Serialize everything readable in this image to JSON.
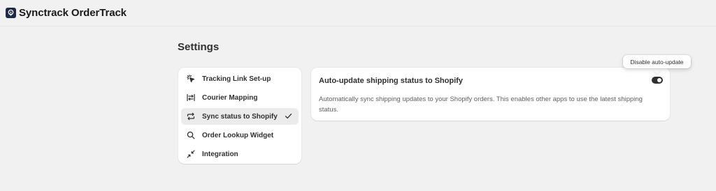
{
  "app": {
    "title": "Synctrack OrderTrack",
    "logo_icon": "location-pin-logo-icon",
    "logo_color": "#1e2a4a"
  },
  "page": {
    "title": "Settings"
  },
  "nav": {
    "items": [
      {
        "label": "Tracking Link Set-up",
        "icon": "cursor-click-icon",
        "active": false
      },
      {
        "label": "Courier Mapping",
        "icon": "mapping-arrows-icon",
        "active": false
      },
      {
        "label": "Sync status to Shopify",
        "icon": "sync-arrows-icon",
        "active": true
      },
      {
        "label": "Order Lookup Widget",
        "icon": "search-icon",
        "active": false
      },
      {
        "label": "Integration",
        "icon": "connect-arrows-icon",
        "active": false
      }
    ],
    "selected_indicator_icon": "checkmark-icon"
  },
  "setting": {
    "title": "Auto-update shipping status to Shopify",
    "description": "Automatically sync shipping updates to your Shopify orders. This enables other apps to use the latest shipping status.",
    "toggle_on": true,
    "toggle_color": "#303030",
    "tooltip": "Disable auto-update"
  },
  "colors": {
    "background": "#f1f1f1",
    "card": "#ffffff",
    "active_nav": "#ebebeb",
    "text_primary": "#303030",
    "text_secondary": "#616161"
  }
}
